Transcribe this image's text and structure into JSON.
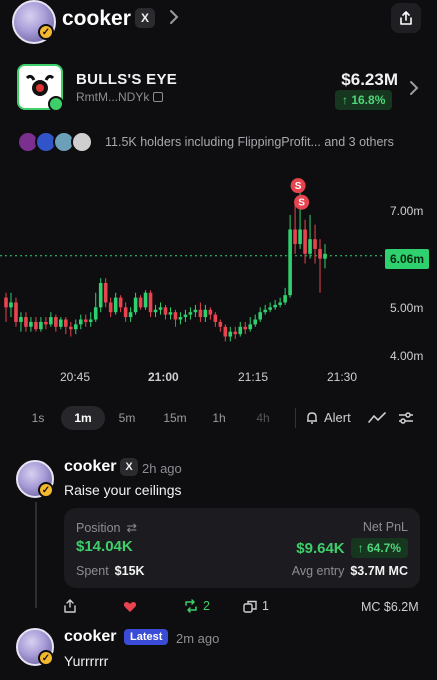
{
  "header": {
    "username": "cooker",
    "x_badge": "X",
    "icons": [
      "chevron-right-icon",
      "share-icon"
    ]
  },
  "token": {
    "name": "BULLS'S EYE",
    "address": "RmtM...NDYk",
    "market_cap": "$6.23M",
    "change": "↑ 16.8%",
    "holders_text": "11.5K holders including FlippingProfit... and 3 others"
  },
  "chart_data": {
    "type": "candlestick",
    "y_ticks": [
      "7.00m",
      "6.00m",
      "5.00m",
      "4.00m"
    ],
    "x_ticks": [
      "20:45",
      "21:00",
      "21:15",
      "21:30"
    ],
    "current_price_label": "6.06m",
    "ylim": [
      3.7,
      7.6
    ],
    "interval": "1m",
    "markers": [
      {
        "label": "S",
        "type": "sell"
      },
      {
        "label": "S",
        "type": "sell"
      }
    ],
    "candles": [
      [
        5.2,
        5.0,
        5.3,
        4.7
      ],
      [
        5.0,
        5.1,
        5.3,
        4.8
      ],
      [
        5.1,
        4.7,
        5.2,
        4.6
      ],
      [
        4.7,
        4.8,
        4.9,
        4.5
      ],
      [
        4.8,
        4.6,
        4.9,
        4.5
      ],
      [
        4.6,
        4.7,
        4.8,
        4.5
      ],
      [
        4.7,
        4.55,
        4.8,
        4.5
      ],
      [
        4.55,
        4.7,
        4.8,
        4.5
      ],
      [
        4.7,
        4.65,
        4.8,
        4.55
      ],
      [
        4.65,
        4.8,
        4.9,
        4.6
      ],
      [
        4.8,
        4.6,
        4.85,
        4.5
      ],
      [
        4.6,
        4.75,
        4.8,
        4.55
      ],
      [
        4.75,
        4.6,
        4.8,
        4.45
      ],
      [
        4.6,
        4.55,
        4.7,
        4.4
      ],
      [
        4.55,
        4.65,
        4.75,
        4.45
      ],
      [
        4.65,
        4.75,
        4.85,
        4.55
      ],
      [
        4.75,
        4.7,
        4.85,
        4.6
      ],
      [
        4.7,
        4.75,
        4.9,
        4.6
      ],
      [
        4.75,
        5.0,
        5.3,
        4.7
      ],
      [
        5.0,
        5.5,
        5.6,
        4.9
      ],
      [
        5.5,
        5.1,
        5.6,
        5.0
      ],
      [
        5.1,
        4.9,
        5.2,
        4.8
      ],
      [
        4.9,
        5.2,
        5.3,
        4.85
      ],
      [
        5.2,
        5.0,
        5.25,
        4.9
      ],
      [
        5.0,
        4.8,
        5.1,
        4.7
      ],
      [
        4.8,
        4.9,
        5.0,
        4.7
      ],
      [
        4.9,
        5.2,
        5.3,
        4.85
      ],
      [
        5.2,
        5.0,
        5.25,
        4.95
      ],
      [
        5.0,
        5.3,
        5.35,
        4.95
      ],
      [
        5.3,
        4.9,
        5.35,
        4.8
      ],
      [
        4.9,
        4.95,
        5.05,
        4.8
      ],
      [
        4.95,
        5.0,
        5.1,
        4.85
      ],
      [
        5.0,
        4.85,
        5.05,
        4.75
      ],
      [
        4.85,
        4.9,
        5.0,
        4.75
      ],
      [
        4.9,
        4.75,
        4.95,
        4.6
      ],
      [
        4.75,
        4.8,
        4.9,
        4.65
      ],
      [
        4.8,
        4.85,
        4.95,
        4.7
      ],
      [
        4.85,
        4.9,
        5.0,
        4.75
      ],
      [
        4.9,
        4.95,
        5.05,
        4.8
      ],
      [
        4.95,
        4.8,
        5.1,
        4.7
      ],
      [
        4.8,
        4.95,
        5.05,
        4.7
      ],
      [
        4.95,
        4.85,
        5.0,
        4.75
      ],
      [
        4.85,
        4.7,
        4.9,
        4.6
      ],
      [
        4.7,
        4.6,
        4.75,
        4.5
      ],
      [
        4.6,
        4.4,
        4.65,
        4.3
      ],
      [
        4.4,
        4.5,
        4.6,
        4.3
      ],
      [
        4.5,
        4.45,
        4.6,
        4.35
      ],
      [
        4.45,
        4.6,
        4.7,
        4.4
      ],
      [
        4.6,
        4.55,
        4.7,
        4.45
      ],
      [
        4.55,
        4.65,
        4.8,
        4.5
      ],
      [
        4.65,
        4.75,
        4.85,
        4.6
      ],
      [
        4.75,
        4.9,
        5.0,
        4.7
      ],
      [
        4.9,
        4.95,
        5.05,
        4.85
      ],
      [
        4.95,
        5.0,
        5.1,
        4.9
      ],
      [
        5.0,
        5.05,
        5.15,
        4.95
      ],
      [
        5.05,
        5.1,
        5.2,
        5.0
      ],
      [
        5.1,
        5.25,
        5.4,
        5.05
      ],
      [
        5.25,
        6.6,
        6.9,
        5.2
      ],
      [
        6.6,
        6.3,
        7.2,
        6.1
      ],
      [
        6.3,
        6.6,
        7.4,
        6.2
      ],
      [
        6.6,
        6.1,
        6.8,
        5.9
      ],
      [
        6.1,
        6.4,
        6.9,
        6.0
      ],
      [
        6.4,
        6.2,
        6.7,
        5.9
      ],
      [
        6.2,
        6.0,
        6.4,
        5.3
      ],
      [
        6.0,
        6.1,
        6.3,
        5.8
      ]
    ]
  },
  "timeframes": [
    {
      "label": "1s",
      "state": "normal"
    },
    {
      "label": "1m",
      "state": "active"
    },
    {
      "label": "5m",
      "state": "normal"
    },
    {
      "label": "15m",
      "state": "normal"
    },
    {
      "label": "1h",
      "state": "normal"
    },
    {
      "label": "4h",
      "state": "dim"
    }
  ],
  "alert_label": "Alert",
  "post1": {
    "author": "cooker",
    "x_badge": "X",
    "time": "2h ago",
    "text": "Raise your ceilings",
    "position": {
      "position_label": "Position",
      "position_value": "$14.04K",
      "pnl_label": "Net PnL",
      "pnl_value": "$9.64K",
      "pnl_pct": "↑ 64.7%",
      "spent_label": "Spent",
      "spent_value": "$15K",
      "avg_label": "Avg entry",
      "avg_value": "$3.7M MC"
    },
    "actions": {
      "retweets": "2",
      "copies": "1",
      "mc": "MC $6.2M"
    }
  },
  "post2": {
    "author": "cooker",
    "badge": "Latest",
    "time": "2m ago",
    "text": "Yurrrrrr"
  },
  "colors": {
    "up": "#2fd16e",
    "down": "#e8444f",
    "background": "#0e0e10"
  }
}
